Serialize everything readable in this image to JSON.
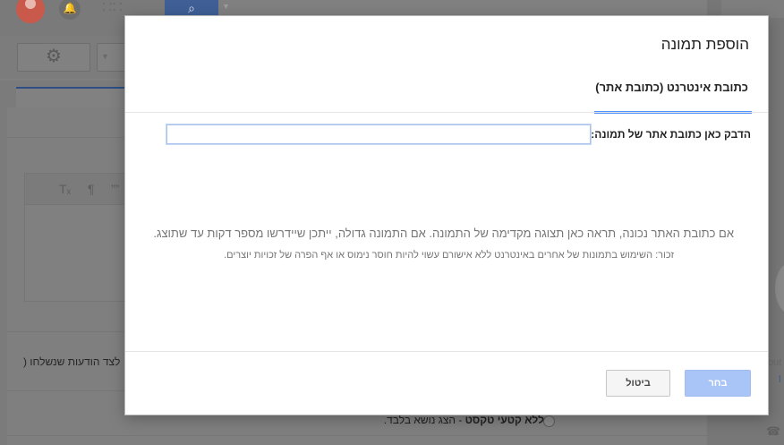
{
  "background": {
    "bell_icon": "bell-icon",
    "apps_icon": "apps-grid-icon",
    "search_icon": "search-icon",
    "gear_icon": "gear-icon",
    "sent_messages_label": ") לצד הודעות שנשלחו",
    "no_snippets_bold": "ללא קטעי טקסט",
    "no_snippets_rest": " - הצג נושא בלבד.",
    "right_panel_text": "out",
    "right_panel_link": "l"
  },
  "dialog": {
    "title": "הוספת תמונה",
    "tab_label": "כתובת אינטרנט (כתובת אתר)",
    "url_label": "הדבק כאן כתובת אתר של תמונה:",
    "url_value": "",
    "hint_preview": "אם כתובת האתר נכונה, תראה כאן תצוגה מקדימה של התמונה. אם התמונה גדולה, ייתכן שיידרשו מספר דקות עד שתוצג.",
    "hint_copyright": "זכור: השימוש בתמונות של אחרים באינטרנט ללא אישורם עשוי להיות חוסר נימוס או אף הפרה של זכויות יוצרים.",
    "select_button": "בחר",
    "cancel_button": "ביטול"
  },
  "colors": {
    "accent": "#4d90fe",
    "select_button_disabled": "#a9c4f7"
  }
}
